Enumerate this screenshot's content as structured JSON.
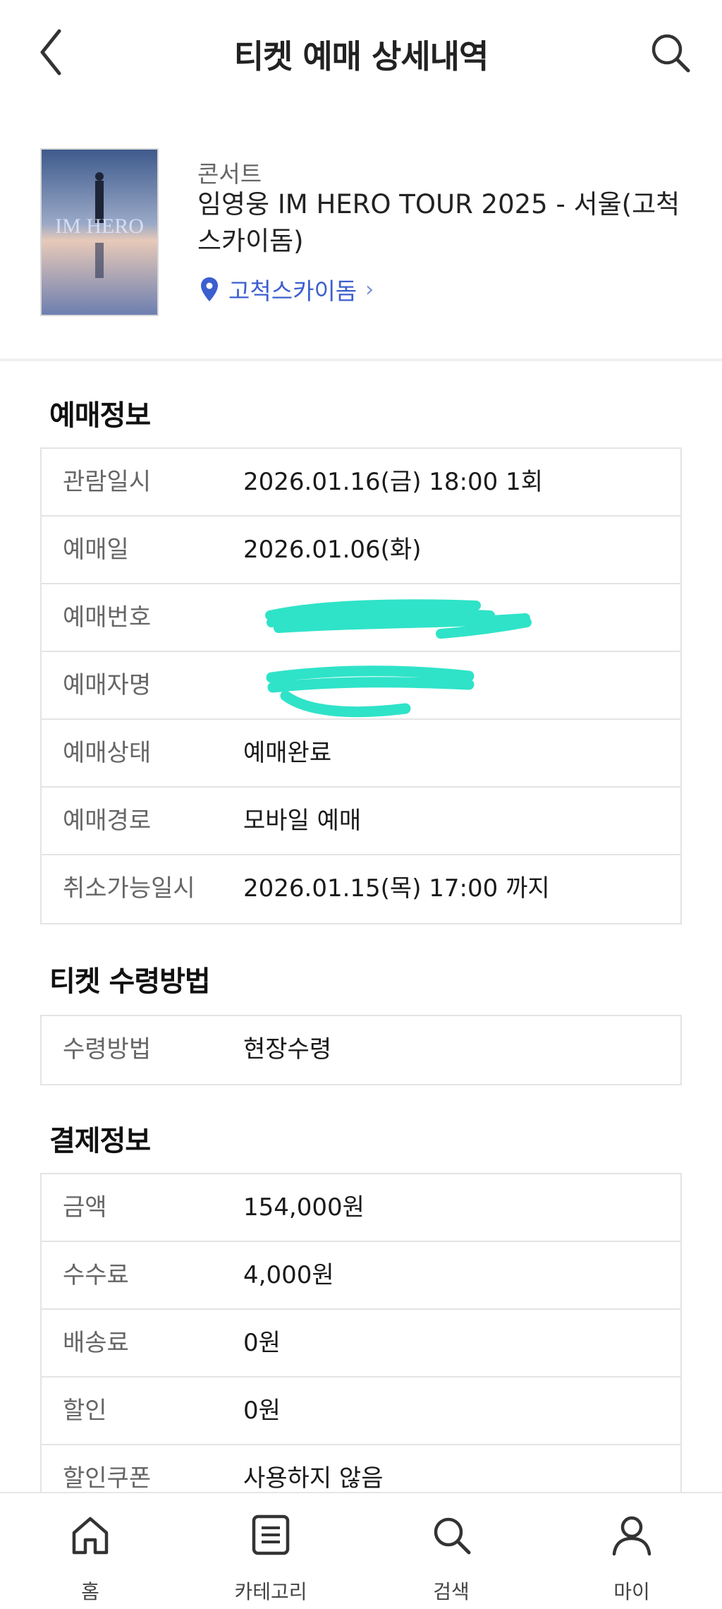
{
  "header": {
    "title": "티켓 예매 상세내역"
  },
  "event": {
    "category": "콘서트",
    "title": "임영웅 IM HERO TOUR 2025 - 서울(고척스카이돔)",
    "venue": "고척스카이돔",
    "poster_text": "IM HERO"
  },
  "reservation": {
    "title": "예매정보",
    "rows": [
      {
        "label": "관람일시",
        "value": "2026.01.16(금) 18:00 1회"
      },
      {
        "label": "예매일",
        "value": "2026.01.06(화)"
      },
      {
        "label": "예매번호",
        "value": ""
      },
      {
        "label": "예매자명",
        "value": ""
      },
      {
        "label": "예매상태",
        "value": "예매완료"
      },
      {
        "label": "예매경로",
        "value": "모바일 예매"
      },
      {
        "label": "취소가능일시",
        "value": "2026.01.15(목) 17:00 까지"
      }
    ]
  },
  "delivery": {
    "title": "티켓 수령방법",
    "rows": [
      {
        "label": "수령방법",
        "value": "현장수령"
      }
    ]
  },
  "payment": {
    "title": "결제정보",
    "rows": [
      {
        "label": "금액",
        "value": "154,000원"
      },
      {
        "label": "수수료",
        "value": "4,000원"
      },
      {
        "label": "배송료",
        "value": "0원"
      },
      {
        "label": "할인",
        "value": "0원"
      },
      {
        "label": "할인쿠폰",
        "value": "사용하지 않음"
      }
    ]
  },
  "nav": {
    "items": [
      {
        "label": "홈",
        "icon": "home-icon"
      },
      {
        "label": "카테고리",
        "icon": "list-icon"
      },
      {
        "label": "검색",
        "icon": "search-icon"
      },
      {
        "label": "마이",
        "icon": "person-icon"
      }
    ]
  },
  "colors": {
    "accent": "#3c5fcf",
    "redaction": "#2fe3c8"
  }
}
